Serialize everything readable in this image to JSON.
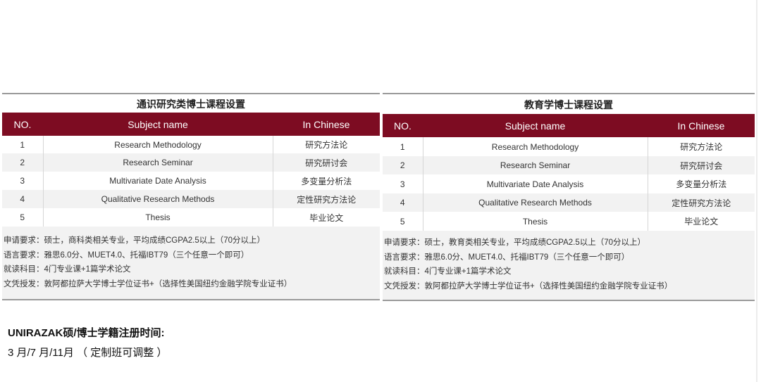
{
  "left_panel": {
    "title": "通识研究类博士课程设置",
    "headers": {
      "no": "NO.",
      "subject": "Subject name",
      "chinese": "In Chinese"
    },
    "rows": [
      {
        "no": "1",
        "subject": "Research Methodology",
        "chinese": "研究方法论"
      },
      {
        "no": "2",
        "subject": "Research Seminar",
        "chinese": "研究研讨会"
      },
      {
        "no": "3",
        "subject": "Multivariate Date Analysis",
        "chinese": "多变量分析法"
      },
      {
        "no": "4",
        "subject": "Qualitative Research Methods",
        "chinese": "定性研究方法论"
      },
      {
        "no": "5",
        "subject": "Thesis",
        "chinese": "毕业论文"
      }
    ],
    "notes": [
      "申请要求：硕士，商科类相关专业，平均成绩CGPA2.5以上（70分以上）",
      "语言要求：雅思6.0分、MUET4.0、托福IBT79（三个任意一个即可）",
      "就读科目：4门专业课+1篇学术论文",
      "文凭授发：敦阿都拉萨大学博士学位证书+（选择性美国纽约金融学院专业证书）"
    ]
  },
  "right_panel": {
    "title": "教育学博士课程设置",
    "headers": {
      "no": "NO.",
      "subject": "Subject name",
      "chinese": "In Chinese"
    },
    "rows": [
      {
        "no": "1",
        "subject": "Research Methodology",
        "chinese": "研究方法论"
      },
      {
        "no": "2",
        "subject": "Research Seminar",
        "chinese": "研究研讨会"
      },
      {
        "no": "3",
        "subject": "Multivariate Date Analysis",
        "chinese": "多变量分析法"
      },
      {
        "no": "4",
        "subject": "Qualitative Research Methods",
        "chinese": "定性研究方法论"
      },
      {
        "no": "5",
        "subject": "Thesis",
        "chinese": "毕业论文"
      }
    ],
    "notes": [
      "申请要求：硕士，教育类相关专业，平均成绩CGPA2.5以上（70分以上）",
      "语言要求：雅思6.0分、MUET4.0、托福IBT79（三个任意一个即可）",
      "就读科目：4门专业课+1篇学术论文",
      "文凭授发：敦阿都拉萨大学博士学位证书+（选择性美国纽约金融学院专业证书）"
    ]
  },
  "registration": {
    "title": "UNIRAZAK硕/博士学籍注册时间:",
    "dates": "3 月/7 月/11月 （ 定制班可调整 ）"
  },
  "colors": {
    "header_bg": "#7d0c22",
    "stripe_bg": "#f2f2f2",
    "rule": "#9a9a9a"
  }
}
